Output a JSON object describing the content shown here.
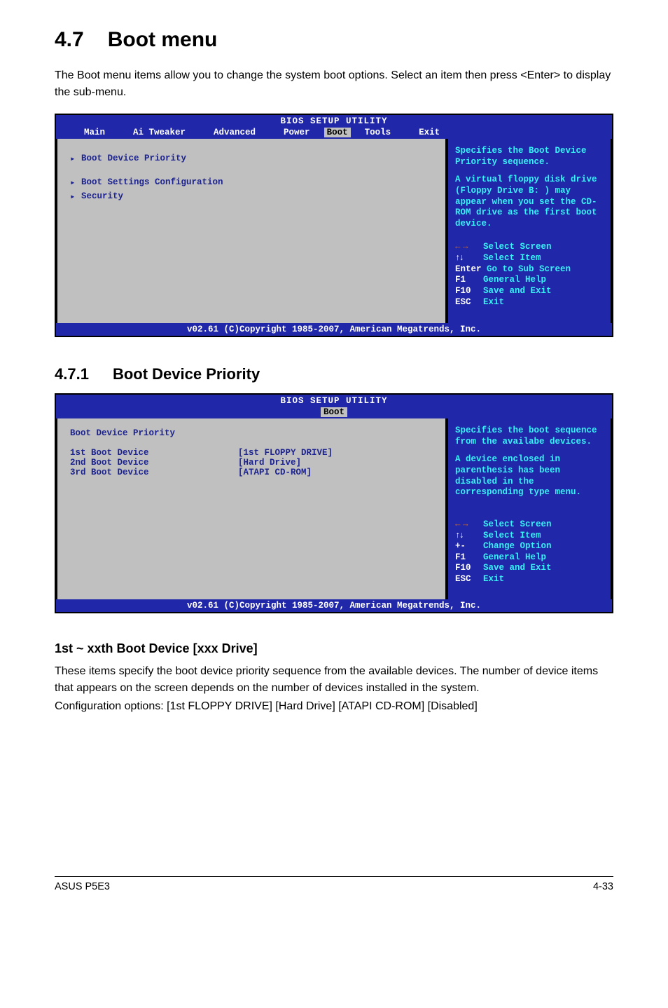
{
  "section": {
    "num": "4.7",
    "title": "Boot menu"
  },
  "intro": "The Boot menu items allow you to change the system boot options. Select an item then press <Enter> to display the sub-menu.",
  "bios1": {
    "title": "BIOS SETUP UTILITY",
    "menu": {
      "main": "Main",
      "ai": "Ai Tweaker",
      "advanced": "Advanced",
      "power": "Power",
      "boot": "Boot",
      "tools": "Tools",
      "exit": "Exit"
    },
    "left": {
      "item1": "Boot Device Priority",
      "item2": "Boot Settings Configuration",
      "item3": "Security"
    },
    "right": {
      "line1": "Specifies the Boot Device Priority sequence.",
      "line2": "A virtual floppy disk drive (Floppy Drive B: ) may appear when you set the CD-ROM drive as the first boot device.",
      "h1": "Select Screen",
      "h2": "Select Item",
      "h3a": "Enter",
      "h3b": "Go to Sub Screen",
      "h4a": "F1",
      "h4b": "General Help",
      "h5a": "F10",
      "h5b": "Save and Exit",
      "h6a": "ESC",
      "h6b": "Exit"
    },
    "footer": "v02.61 (C)Copyright 1985-2007, American Megatrends, Inc."
  },
  "subsection": {
    "num": "4.7.1",
    "title": "Boot Device Priority"
  },
  "bios2": {
    "title": "BIOS SETUP UTILITY",
    "menu": {
      "boot": "Boot"
    },
    "left": {
      "head": "Boot Device Priority",
      "d1a": "1st Boot Device",
      "d1b": "[1st FLOPPY DRIVE]",
      "d2a": "2nd Boot Device",
      "d2b": "[Hard Drive]",
      "d3a": "3rd Boot Device",
      "d3b": "[ATAPI CD-ROM]"
    },
    "right": {
      "line1": "Specifies the boot sequence from the availabe devices.",
      "line2": "A device enclosed in parenthesis has been disabled in the corresponding type menu.",
      "h1": "Select Screen",
      "h2": "Select Item",
      "h3a": "+-",
      "h3b": "Change Option",
      "h4a": "F1",
      "h4b": "General Help",
      "h5a": "F10",
      "h5b": "Save and Exit",
      "h6a": "ESC",
      "h6b": "Exit"
    },
    "footer": "v02.61 (C)Copyright 1985-2007, American Megatrends, Inc."
  },
  "subheading": "1st ~ xxth Boot Device [xxx Drive]",
  "sub_para": "These items specify the boot device priority sequence from the available devices. The number of device items that appears on the screen depends on the number of devices installed in the system.",
  "config": "Configuration options: [1st FLOPPY DRIVE] [Hard Drive] [ATAPI CD-ROM] [Disabled]",
  "footer": {
    "left": "ASUS P5E3",
    "right": "4-33"
  }
}
